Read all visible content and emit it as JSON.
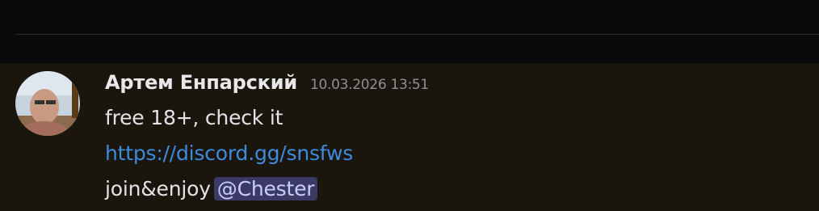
{
  "message": {
    "author": "Артем Енпарский",
    "timestamp": "10.03.2026 13:51",
    "avatar_icon": "user-avatar",
    "lines": {
      "text1": "free 18+, check it",
      "link": "https://discord.gg/snsfws",
      "text3": "join&enjoy"
    },
    "mention": "@Chester"
  },
  "colors": {
    "message_bg": "#1b160d",
    "top_bg": "#09090c",
    "link": "#3d8bdc",
    "mention_bg": "#3a3a64",
    "mention_text": "#c9cdfb"
  }
}
